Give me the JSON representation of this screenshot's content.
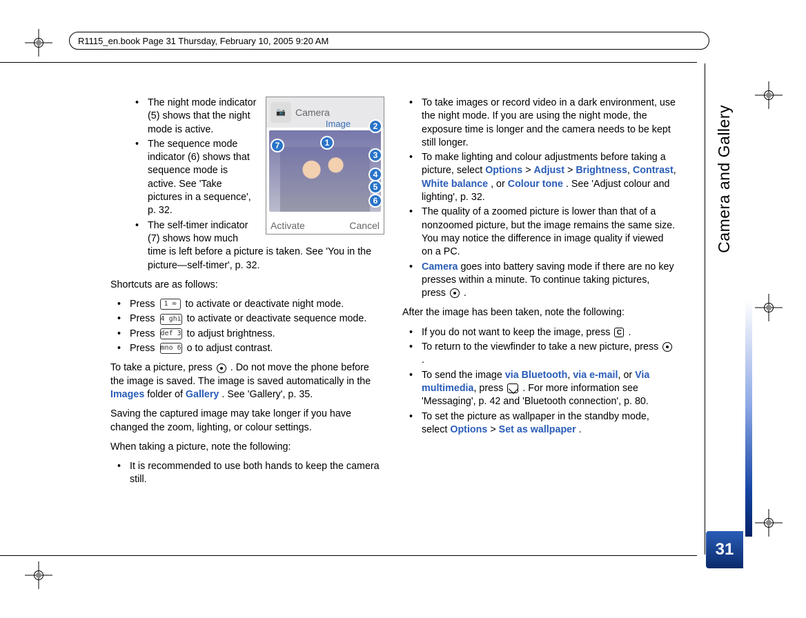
{
  "header": {
    "crop_info": "R1115_en.book  Page 31  Thursday, February 10, 2005  9:20 AM"
  },
  "section": "Camera and Gallery",
  "page_number": "31",
  "figure": {
    "title": "Camera",
    "subtitle": "Image",
    "left_soft": "Activate",
    "right_soft": "Cancel",
    "callouts": {
      "1": "1",
      "2": "2",
      "3": "3",
      "4": "4",
      "5": "5",
      "6": "6",
      "7": "7"
    }
  },
  "col1": {
    "b1": "The night mode indicator (5) shows that the night mode is active.",
    "b2": "The sequence mode indicator (6) shows that sequence mode is active. See 'Take pictures in a sequence', p. 32.",
    "b3": "The self-timer indicator (7) shows how much time is left before a picture is taken. See 'You in the picture—self-timer', p. 32.",
    "shortcuts_intro": "Shortcuts are as follows:",
    "s1a": "Press ",
    "s1b": " to activate or deactivate night mode.",
    "s2a": "Press ",
    "s2b": " to activate or deactivate sequence mode.",
    "s3a": "Press ",
    "s3b": " to adjust brightness.",
    "s4a": "Press ",
    "s4b": " o to adjust contrast.",
    "take_pic_a": "To take a picture, press ",
    "take_pic_b": ". Do not move the phone before the image is saved. The image is saved automatically in the ",
    "take_pic_images": "Images",
    "take_pic_c": " folder of ",
    "take_pic_gallery": "Gallery",
    "take_pic_d": ". See 'Gallery', p. 35.",
    "saving": "Saving the captured image may take longer if you have changed the zoom, lighting, or colour settings.",
    "when_taking": "When taking a picture, note the following:",
    "wt1": "It is recommended to use both hands to keep the camera still."
  },
  "col2": {
    "d1": "To take images or record video in a dark environment, use the night mode. If you are using the night mode, the exposure time is longer and the camera needs to be kept still longer.",
    "d2a": "To make lighting and colour adjustments before taking a picture, select ",
    "d2_opt": "Options",
    "d2_gt1": " > ",
    "d2_adj": "Adjust",
    "d2_gt2": " > ",
    "d2_br": "Brightness",
    "d2_c1": ", ",
    "d2_co": "Contrast",
    "d2_c2": ", ",
    "d2_wb": "White balance ",
    "d2_or": ", or ",
    "d2_ct": "Colour tone",
    "d2_end": ". See 'Adjust colour and lighting', p. 32.",
    "d3": "The quality of a zoomed picture is lower than that of a nonzoomed picture, but the image remains the same size. You may notice the difference in image quality if viewed on a PC.",
    "d4a_cam": "Camera",
    "d4b": " goes into battery saving mode if there are no key presses within a minute. To continue taking pictures, press ",
    "d4c": ".",
    "after_intro": "After the image has been taken, note the following:",
    "a1a": "If you do not want to keep the image, press ",
    "a1b": ".",
    "a2a": "To return to the viewfinder to take a new picture, press ",
    "a2b": ".",
    "a3a": "To send the image ",
    "a3_bt": "via Bluetooth",
    "a3_c1": ", ",
    "a3_em": "via e-mail",
    "a3_c2": ", or ",
    "a3_mm": "Via multimedia",
    "a3_c3": ", press ",
    "a3_end": ". For more information see 'Messaging', p. 42 and 'Bluetooth connection', p. 80.",
    "a4a": "To set the picture as wallpaper in the standby mode, select ",
    "a4_opt": "Options",
    "a4_gt": " > ",
    "a4_sw": "Set as wallpaper",
    "a4_end": ".",
    "key1": "1  ∞",
    "key4": "4 ghi",
    "key3": "def 3",
    "key6": "mno 6",
    "keyC": "C"
  }
}
